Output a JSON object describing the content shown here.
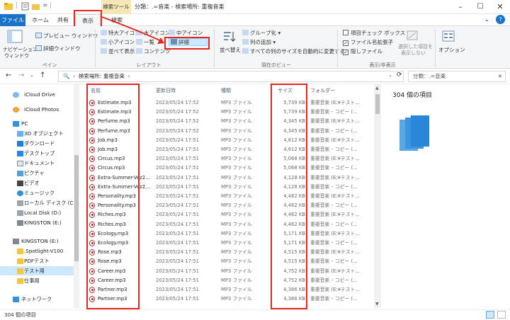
{
  "titlebar": {
    "context_tab": "検索ツール",
    "title": "分類：.=音楽 - 検索場所: 重複音楽"
  },
  "tabs": [
    {
      "label": "ファイル"
    },
    {
      "label": "ホーム"
    },
    {
      "label": "共有"
    },
    {
      "label": "表示"
    },
    {
      "label": "検索"
    }
  ],
  "ribbon": {
    "pane": {
      "nav_pane": "ナビゲーション",
      "nav_pane2": "ウィンドウ",
      "preview": "プレビュー ウィンドウ",
      "details": "詳細ウィンドウ",
      "group": "ペイン"
    },
    "layout": {
      "items": [
        "特大アイコン",
        "大アイコン",
        "中アイコン",
        "小アイコン",
        "一覧",
        "詳細",
        "並べて表示",
        "コンテンツ"
      ],
      "group": "レイアウト"
    },
    "current_view": {
      "sort": "並べ替え",
      "group_by": "グループ化",
      "add_column": "列の追加",
      "fit_columns": "すべての列のサイズを自動的に変更する",
      "group": "現在のビュー"
    },
    "show_hide": {
      "checkboxes": "項目チェック ボックス",
      "extensions": "ファイル名拡張子",
      "hidden": "隠しファイル",
      "hide_selected": "選択した項目を",
      "hide_selected2": "表示しない",
      "options": "オプション",
      "group": "表示/非表示"
    }
  },
  "navbar": {
    "address": "検索場所: 重複音楽",
    "search": "分類：.=音楽"
  },
  "sidebar": {
    "items": [
      {
        "label": "iCloud Drive",
        "icon": "cloud-icon"
      },
      {
        "label": "iCloud Photos",
        "icon": "photos-icon"
      },
      {
        "label": "PC",
        "icon": "pc-icon"
      },
      {
        "label": "3D オブジェクト",
        "icon": "cube-icon"
      },
      {
        "label": "ダウンロード",
        "icon": "download-icon"
      },
      {
        "label": "デスクトップ",
        "icon": "desktop-icon"
      },
      {
        "label": "ドキュメント",
        "icon": "document-icon"
      },
      {
        "label": "ピクチャ",
        "icon": "picture-icon"
      },
      {
        "label": "ビデオ",
        "icon": "video-icon"
      },
      {
        "label": "ミュージック",
        "icon": "music-icon"
      },
      {
        "label": "ローカル ディスク (C:)",
        "icon": "disk-icon"
      },
      {
        "label": "Local Disk (D:)",
        "icon": "disk-icon"
      },
      {
        "label": "KINGSTON (E:)",
        "icon": "usb-icon"
      },
      {
        "label": "KINGSTON (E:)",
        "icon": "usb-icon"
      },
      {
        "label": ".Spotlight-V100",
        "icon": "folder-icon"
      },
      {
        "label": "PDFテスト",
        "icon": "folder-icon"
      },
      {
        "label": "テスト用",
        "icon": "folder-icon"
      },
      {
        "label": "仕事用",
        "icon": "folder-icon"
      },
      {
        "label": "ネットワーク",
        "icon": "network-icon"
      }
    ]
  },
  "columns": {
    "name": "名前",
    "date": "更新日時",
    "type": "種類",
    "size": "サイズ",
    "folder": "フォルダー"
  },
  "files": [
    {
      "name": "Estimate.mp3",
      "date": "2023/05/24 17:52",
      "type": "MP3 ファイル",
      "size": "5,739 KB",
      "folder": "重複音楽 (E:¥テスト..."
    },
    {
      "name": "Estimate.mp3",
      "date": "2023/05/24 17:52",
      "type": "MP3 ファイル",
      "size": "5,739 KB",
      "folder": "重複音楽 – コピー (..."
    },
    {
      "name": "Perfume.mp3",
      "date": "2023/05/24 17:52",
      "type": "MP3 ファイル",
      "size": "4,345 KB",
      "folder": "重複音楽 (E:¥テスト..."
    },
    {
      "name": "Perfume.mp3",
      "date": "2023/05/24 17:52",
      "type": "MP3 ファイル",
      "size": "4,345 KB",
      "folder": "重複音楽 – コピー (..."
    },
    {
      "name": "Job.mp3",
      "date": "2023/05/24 17:51",
      "type": "MP3 ファイル",
      "size": "4,612 KB",
      "folder": "重複音楽 (E:¥テスト..."
    },
    {
      "name": "Job.mp3",
      "date": "2023/05/24 17:51",
      "type": "MP3 ファイル",
      "size": "4,612 KB",
      "folder": "重複音楽 – コピー (..."
    },
    {
      "name": "Circus.mp3",
      "date": "2023/05/24 17:51",
      "type": "MP3 ファイル",
      "size": "5,068 KB",
      "folder": "重複音楽 (E:¥テスト..."
    },
    {
      "name": "Circus.mp3",
      "date": "2023/05/24 17:51",
      "type": "MP3 ファイル",
      "size": "5,068 KB",
      "folder": "重複音楽 – コピー (..."
    },
    {
      "name": "Extra-Summer-Vez2....",
      "date": "2023/05/24 17:51",
      "type": "MP3 ファイル",
      "size": "4,128 KB",
      "folder": "重複音楽 (E:¥テスト..."
    },
    {
      "name": "Extra-Summer-Vez2....",
      "date": "2023/05/24 17:51",
      "type": "MP3 ファイル",
      "size": "4,128 KB",
      "folder": "重複音楽 – コピー (..."
    },
    {
      "name": "Personality.mp3",
      "date": "2023/05/24 17:51",
      "type": "MP3 ファイル",
      "size": "4,482 KB",
      "folder": "重複音楽 (E:¥テスト..."
    },
    {
      "name": "Personality.mp3",
      "date": "2023/05/24 17:51",
      "type": "MP3 ファイル",
      "size": "4,482 KB",
      "folder": "重複音楽 – コピー (..."
    },
    {
      "name": "Riches.mp3",
      "date": "2023/05/24 17:51",
      "type": "MP3 ファイル",
      "size": "4,462 KB",
      "folder": "重複音楽 (E:¥テスト..."
    },
    {
      "name": "Riches.mp3",
      "date": "2023/05/24 17:51",
      "type": "MP3 ファイル",
      "size": "4,462 KB",
      "folder": "重複音楽 – コピー (..."
    },
    {
      "name": "Ecology.mp3",
      "date": "2023/05/24 17:51",
      "type": "MP3 ファイル",
      "size": "5,171 KB",
      "folder": "重複音楽 (E:¥テスト..."
    },
    {
      "name": "Ecology.mp3",
      "date": "2023/05/24 17:51",
      "type": "MP3 ファイル",
      "size": "5,171 KB",
      "folder": "重複音楽 – コピー (..."
    },
    {
      "name": "Rose.mp3",
      "date": "2023/05/24 17:51",
      "type": "MP3 ファイル",
      "size": "4,515 KB",
      "folder": "重複音楽 (E:¥テスト..."
    },
    {
      "name": "Rose.mp3",
      "date": "2023/05/24 17:51",
      "type": "MP3 ファイル",
      "size": "4,515 KB",
      "folder": "重複音楽 – コピー (..."
    },
    {
      "name": "Career.mp3",
      "date": "2023/05/24 17:51",
      "type": "MP3 ファイル",
      "size": "4,752 KB",
      "folder": "重複音楽 (E:¥テスト..."
    },
    {
      "name": "Career.mp3",
      "date": "2023/05/24 17:51",
      "type": "MP3 ファイル",
      "size": "4,752 KB",
      "folder": "重複音楽 – コピー (..."
    },
    {
      "name": "Partner.mp3",
      "date": "2023/05/24 17:51",
      "type": "MP3 ファイル",
      "size": "4,386 KB",
      "folder": "重複音楽 (E:¥テスト..."
    },
    {
      "name": "Partner.mp3",
      "date": "2023/05/24 17:51",
      "type": "MP3 ファイル",
      "size": "4,386 KB",
      "folder": "重複音楽 – コピー (..."
    }
  ],
  "preview": {
    "count": "304 個の項目"
  },
  "status": {
    "count": "304 個の項目"
  },
  "colors": {
    "highlight": "#e8261d",
    "file_tab": "#1a73c6",
    "selection": "#cce8ff"
  }
}
